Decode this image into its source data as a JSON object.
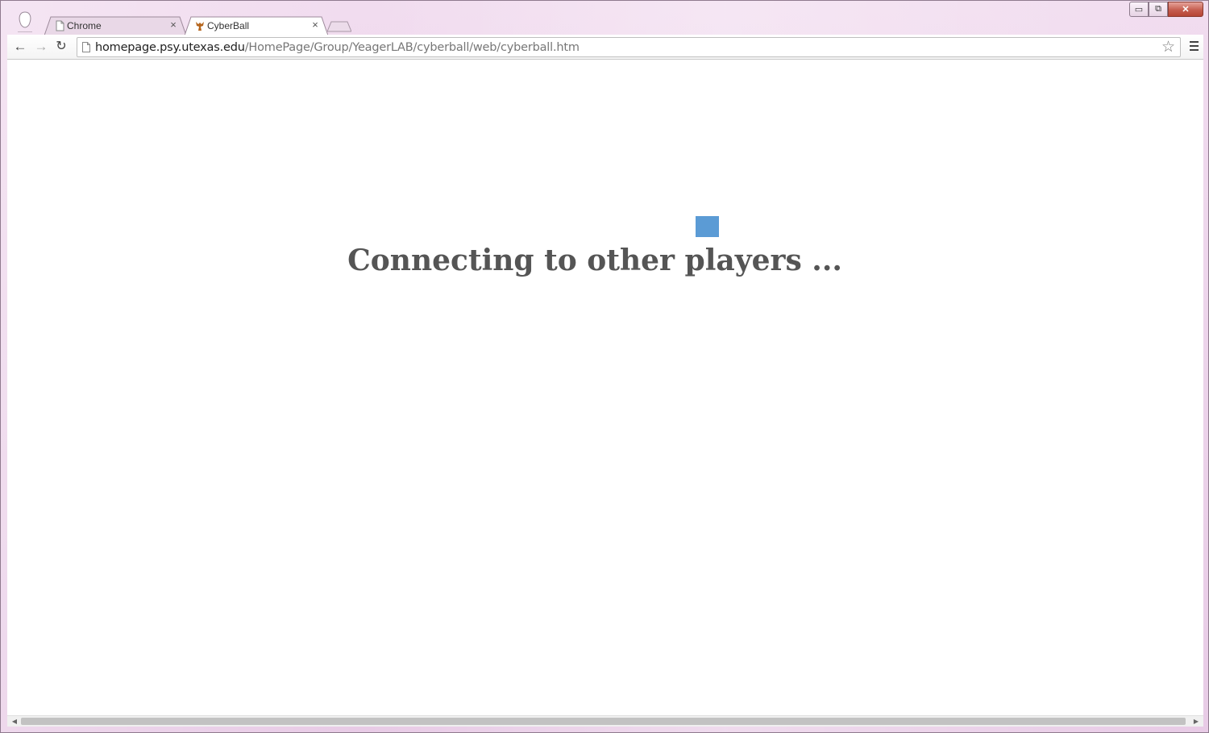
{
  "window": {
    "controls": {
      "minimize": "▭",
      "maximize": "⧉",
      "close": "✕"
    }
  },
  "tabs": [
    {
      "title": "Chrome",
      "icon": "page-icon",
      "active": false,
      "close": "×"
    },
    {
      "title": "CyberBall",
      "icon": "ut-logo-icon",
      "active": true,
      "close": "×"
    }
  ],
  "toolbar": {
    "back": "←",
    "forward": "→",
    "reload": "↻",
    "url_host": "homepage.psy.utexas.edu",
    "url_path": "/HomePage/Group/YeagerLAB/cyberball/web/cyberball.htm",
    "star": "☆"
  },
  "content": {
    "status_text": "Connecting to other players ...",
    "loader_color": "#5b9bd5"
  },
  "scrollbar": {
    "left": "◀",
    "right": "▶"
  }
}
